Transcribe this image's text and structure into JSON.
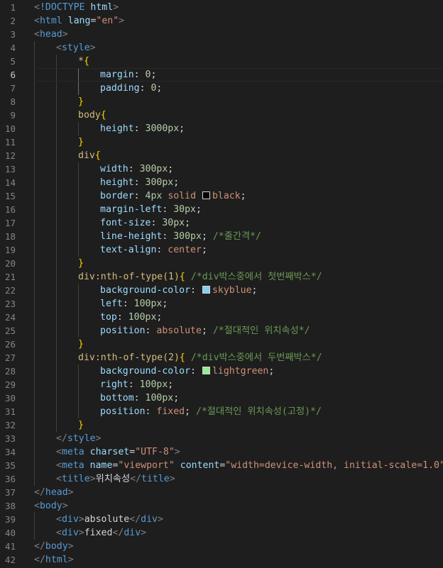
{
  "editor": {
    "active_line": 6,
    "lines": [
      {
        "n": "1",
        "indent": 0,
        "tokens": [
          [
            "punct",
            "<"
          ],
          [
            "dt",
            "!DOCTYPE "
          ],
          [
            "attr",
            "html"
          ],
          [
            "punct",
            ">"
          ]
        ]
      },
      {
        "n": "2",
        "indent": 0,
        "tokens": [
          [
            "punct",
            "<"
          ],
          [
            "tag",
            "html"
          ],
          [
            "txt",
            " "
          ],
          [
            "attr",
            "lang"
          ],
          [
            "txt",
            "="
          ],
          [
            "str",
            "\"en\""
          ],
          [
            "punct",
            ">"
          ]
        ]
      },
      {
        "n": "3",
        "indent": 0,
        "tokens": [
          [
            "punct",
            "<"
          ],
          [
            "tag",
            "head"
          ],
          [
            "punct",
            ">"
          ]
        ]
      },
      {
        "n": "4",
        "indent": 1,
        "tokens": [
          [
            "punct",
            "<"
          ],
          [
            "tag",
            "style"
          ],
          [
            "punct",
            ">"
          ]
        ]
      },
      {
        "n": "5",
        "indent": 2,
        "tokens": [
          [
            "sel",
            "*"
          ],
          [
            "brace",
            "{"
          ]
        ]
      },
      {
        "n": "6",
        "indent": 3,
        "tokens": [
          [
            "prop",
            "margin"
          ],
          [
            "txt",
            ": "
          ],
          [
            "num",
            "0"
          ],
          [
            "txt",
            ";"
          ]
        ]
      },
      {
        "n": "7",
        "indent": 3,
        "tokens": [
          [
            "prop",
            "padding"
          ],
          [
            "txt",
            ": "
          ],
          [
            "num",
            "0"
          ],
          [
            "txt",
            ";"
          ]
        ]
      },
      {
        "n": "8",
        "indent": 2,
        "tokens": [
          [
            "brace",
            "}"
          ]
        ]
      },
      {
        "n": "9",
        "indent": 2,
        "tokens": [
          [
            "sel",
            "body"
          ],
          [
            "brace",
            "{"
          ]
        ]
      },
      {
        "n": "10",
        "indent": 3,
        "tokens": [
          [
            "prop",
            "height"
          ],
          [
            "txt",
            ": "
          ],
          [
            "num",
            "3000px"
          ],
          [
            "txt",
            ";"
          ]
        ]
      },
      {
        "n": "11",
        "indent": 2,
        "tokens": [
          [
            "brace",
            "}"
          ]
        ]
      },
      {
        "n": "12",
        "indent": 2,
        "tokens": [
          [
            "sel",
            "div"
          ],
          [
            "brace",
            "{"
          ]
        ]
      },
      {
        "n": "13",
        "indent": 3,
        "tokens": [
          [
            "prop",
            "width"
          ],
          [
            "txt",
            ": "
          ],
          [
            "num",
            "300px"
          ],
          [
            "txt",
            ";"
          ]
        ]
      },
      {
        "n": "14",
        "indent": 3,
        "tokens": [
          [
            "prop",
            "height"
          ],
          [
            "txt",
            ": "
          ],
          [
            "num",
            "300px"
          ],
          [
            "txt",
            ";"
          ]
        ]
      },
      {
        "n": "15",
        "indent": 3,
        "tokens": [
          [
            "prop",
            "border"
          ],
          [
            "txt",
            ": "
          ],
          [
            "num",
            "4px"
          ],
          [
            "txt",
            " "
          ],
          [
            "val",
            "solid"
          ],
          [
            "txt",
            " "
          ],
          [
            "swatch",
            "#000000"
          ],
          [
            "val",
            "black"
          ],
          [
            "txt",
            ";"
          ]
        ]
      },
      {
        "n": "16",
        "indent": 3,
        "tokens": [
          [
            "prop",
            "margin-left"
          ],
          [
            "txt",
            ": "
          ],
          [
            "num",
            "30px"
          ],
          [
            "txt",
            ";"
          ]
        ]
      },
      {
        "n": "17",
        "indent": 3,
        "tokens": [
          [
            "prop",
            "font-size"
          ],
          [
            "txt",
            ": "
          ],
          [
            "num",
            "30px"
          ],
          [
            "txt",
            ";"
          ]
        ]
      },
      {
        "n": "18",
        "indent": 3,
        "tokens": [
          [
            "prop",
            "line-height"
          ],
          [
            "txt",
            ": "
          ],
          [
            "num",
            "300px"
          ],
          [
            "txt",
            "; "
          ],
          [
            "com",
            "/*줄간격*/"
          ]
        ]
      },
      {
        "n": "19",
        "indent": 3,
        "tokens": [
          [
            "prop",
            "text-align"
          ],
          [
            "txt",
            ": "
          ],
          [
            "val",
            "center"
          ],
          [
            "txt",
            ";"
          ]
        ]
      },
      {
        "n": "20",
        "indent": 2,
        "tokens": [
          [
            "brace",
            "}"
          ]
        ]
      },
      {
        "n": "21",
        "indent": 2,
        "tokens": [
          [
            "sel",
            "div:nth-of-type(1)"
          ],
          [
            "brace",
            "{"
          ],
          [
            "txt",
            " "
          ],
          [
            "com",
            "/*div박스중에서 첫번째박스*/"
          ]
        ]
      },
      {
        "n": "22",
        "indent": 3,
        "tokens": [
          [
            "prop",
            "background-color"
          ],
          [
            "txt",
            ": "
          ],
          [
            "swatch",
            "#87ceeb"
          ],
          [
            "val",
            "skyblue"
          ],
          [
            "txt",
            ";"
          ]
        ]
      },
      {
        "n": "23",
        "indent": 3,
        "tokens": [
          [
            "prop",
            "left"
          ],
          [
            "txt",
            ": "
          ],
          [
            "num",
            "100px"
          ],
          [
            "txt",
            ";"
          ]
        ]
      },
      {
        "n": "24",
        "indent": 3,
        "tokens": [
          [
            "prop",
            "top"
          ],
          [
            "txt",
            ": "
          ],
          [
            "num",
            "100px"
          ],
          [
            "txt",
            ";"
          ]
        ]
      },
      {
        "n": "25",
        "indent": 3,
        "tokens": [
          [
            "prop",
            "position"
          ],
          [
            "txt",
            ": "
          ],
          [
            "val",
            "absolute"
          ],
          [
            "txt",
            "; "
          ],
          [
            "com",
            "/*절대적인 위치속성*/"
          ]
        ]
      },
      {
        "n": "26",
        "indent": 2,
        "tokens": [
          [
            "brace",
            "}"
          ]
        ]
      },
      {
        "n": "27",
        "indent": 2,
        "tokens": [
          [
            "sel",
            "div:nth-of-type(2)"
          ],
          [
            "brace",
            "{"
          ],
          [
            "txt",
            " "
          ],
          [
            "com",
            "/*div박스중에서 두번째박스*/"
          ]
        ]
      },
      {
        "n": "28",
        "indent": 3,
        "tokens": [
          [
            "prop",
            "background-color"
          ],
          [
            "txt",
            ": "
          ],
          [
            "swatch",
            "#90ee90"
          ],
          [
            "val",
            "lightgreen"
          ],
          [
            "txt",
            ";"
          ]
        ]
      },
      {
        "n": "29",
        "indent": 3,
        "tokens": [
          [
            "prop",
            "right"
          ],
          [
            "txt",
            ": "
          ],
          [
            "num",
            "100px"
          ],
          [
            "txt",
            ";"
          ]
        ]
      },
      {
        "n": "30",
        "indent": 3,
        "tokens": [
          [
            "prop",
            "bottom"
          ],
          [
            "txt",
            ": "
          ],
          [
            "num",
            "100px"
          ],
          [
            "txt",
            ";"
          ]
        ]
      },
      {
        "n": "31",
        "indent": 3,
        "tokens": [
          [
            "prop",
            "position"
          ],
          [
            "txt",
            ": "
          ],
          [
            "val",
            "fixed"
          ],
          [
            "txt",
            "; "
          ],
          [
            "com",
            "/*절대적인 위치속성(고정)*/"
          ]
        ]
      },
      {
        "n": "32",
        "indent": 2,
        "tokens": [
          [
            "brace",
            "}"
          ]
        ]
      },
      {
        "n": "33",
        "indent": 1,
        "tokens": [
          [
            "punct",
            "</"
          ],
          [
            "tag",
            "style"
          ],
          [
            "punct",
            ">"
          ]
        ]
      },
      {
        "n": "34",
        "indent": 1,
        "tokens": [
          [
            "punct",
            "<"
          ],
          [
            "tag",
            "meta"
          ],
          [
            "txt",
            " "
          ],
          [
            "attr",
            "charset"
          ],
          [
            "txt",
            "="
          ],
          [
            "str",
            "\"UTF-8\""
          ],
          [
            "punct",
            ">"
          ]
        ]
      },
      {
        "n": "35",
        "indent": 1,
        "tokens": [
          [
            "punct",
            "<"
          ],
          [
            "tag",
            "meta"
          ],
          [
            "txt",
            " "
          ],
          [
            "attr",
            "name"
          ],
          [
            "txt",
            "="
          ],
          [
            "str",
            "\"viewport\""
          ],
          [
            "txt",
            " "
          ],
          [
            "attr",
            "content"
          ],
          [
            "txt",
            "="
          ],
          [
            "str",
            "\"width=device-width, initial-scale=1.0\""
          ],
          [
            "punct",
            ">"
          ]
        ]
      },
      {
        "n": "36",
        "indent": 1,
        "tokens": [
          [
            "punct",
            "<"
          ],
          [
            "tag",
            "title"
          ],
          [
            "punct",
            ">"
          ],
          [
            "txt",
            "위치속성"
          ],
          [
            "punct",
            "</"
          ],
          [
            "tag",
            "title"
          ],
          [
            "punct",
            ">"
          ]
        ]
      },
      {
        "n": "37",
        "indent": 0,
        "tokens": [
          [
            "punct",
            "</"
          ],
          [
            "tag",
            "head"
          ],
          [
            "punct",
            ">"
          ]
        ]
      },
      {
        "n": "38",
        "indent": 0,
        "tokens": [
          [
            "punct",
            "<"
          ],
          [
            "tag",
            "body"
          ],
          [
            "punct",
            ">"
          ]
        ]
      },
      {
        "n": "39",
        "indent": 1,
        "tokens": [
          [
            "punct",
            "<"
          ],
          [
            "tag",
            "div"
          ],
          [
            "punct",
            ">"
          ],
          [
            "txt",
            "absolute"
          ],
          [
            "punct",
            "</"
          ],
          [
            "tag",
            "div"
          ],
          [
            "punct",
            ">"
          ]
        ]
      },
      {
        "n": "40",
        "indent": 1,
        "tokens": [
          [
            "punct",
            "<"
          ],
          [
            "tag",
            "div"
          ],
          [
            "punct",
            ">"
          ],
          [
            "txt",
            "fixed"
          ],
          [
            "punct",
            "</"
          ],
          [
            "tag",
            "div"
          ],
          [
            "punct",
            ">"
          ]
        ]
      },
      {
        "n": "41",
        "indent": 0,
        "tokens": [
          [
            "punct",
            "</"
          ],
          [
            "tag",
            "body"
          ],
          [
            "punct",
            ">"
          ]
        ]
      },
      {
        "n": "42",
        "indent": 0,
        "tokens": [
          [
            "punct",
            "</"
          ],
          [
            "tag",
            "html"
          ],
          [
            "punct",
            ">"
          ]
        ]
      }
    ]
  }
}
